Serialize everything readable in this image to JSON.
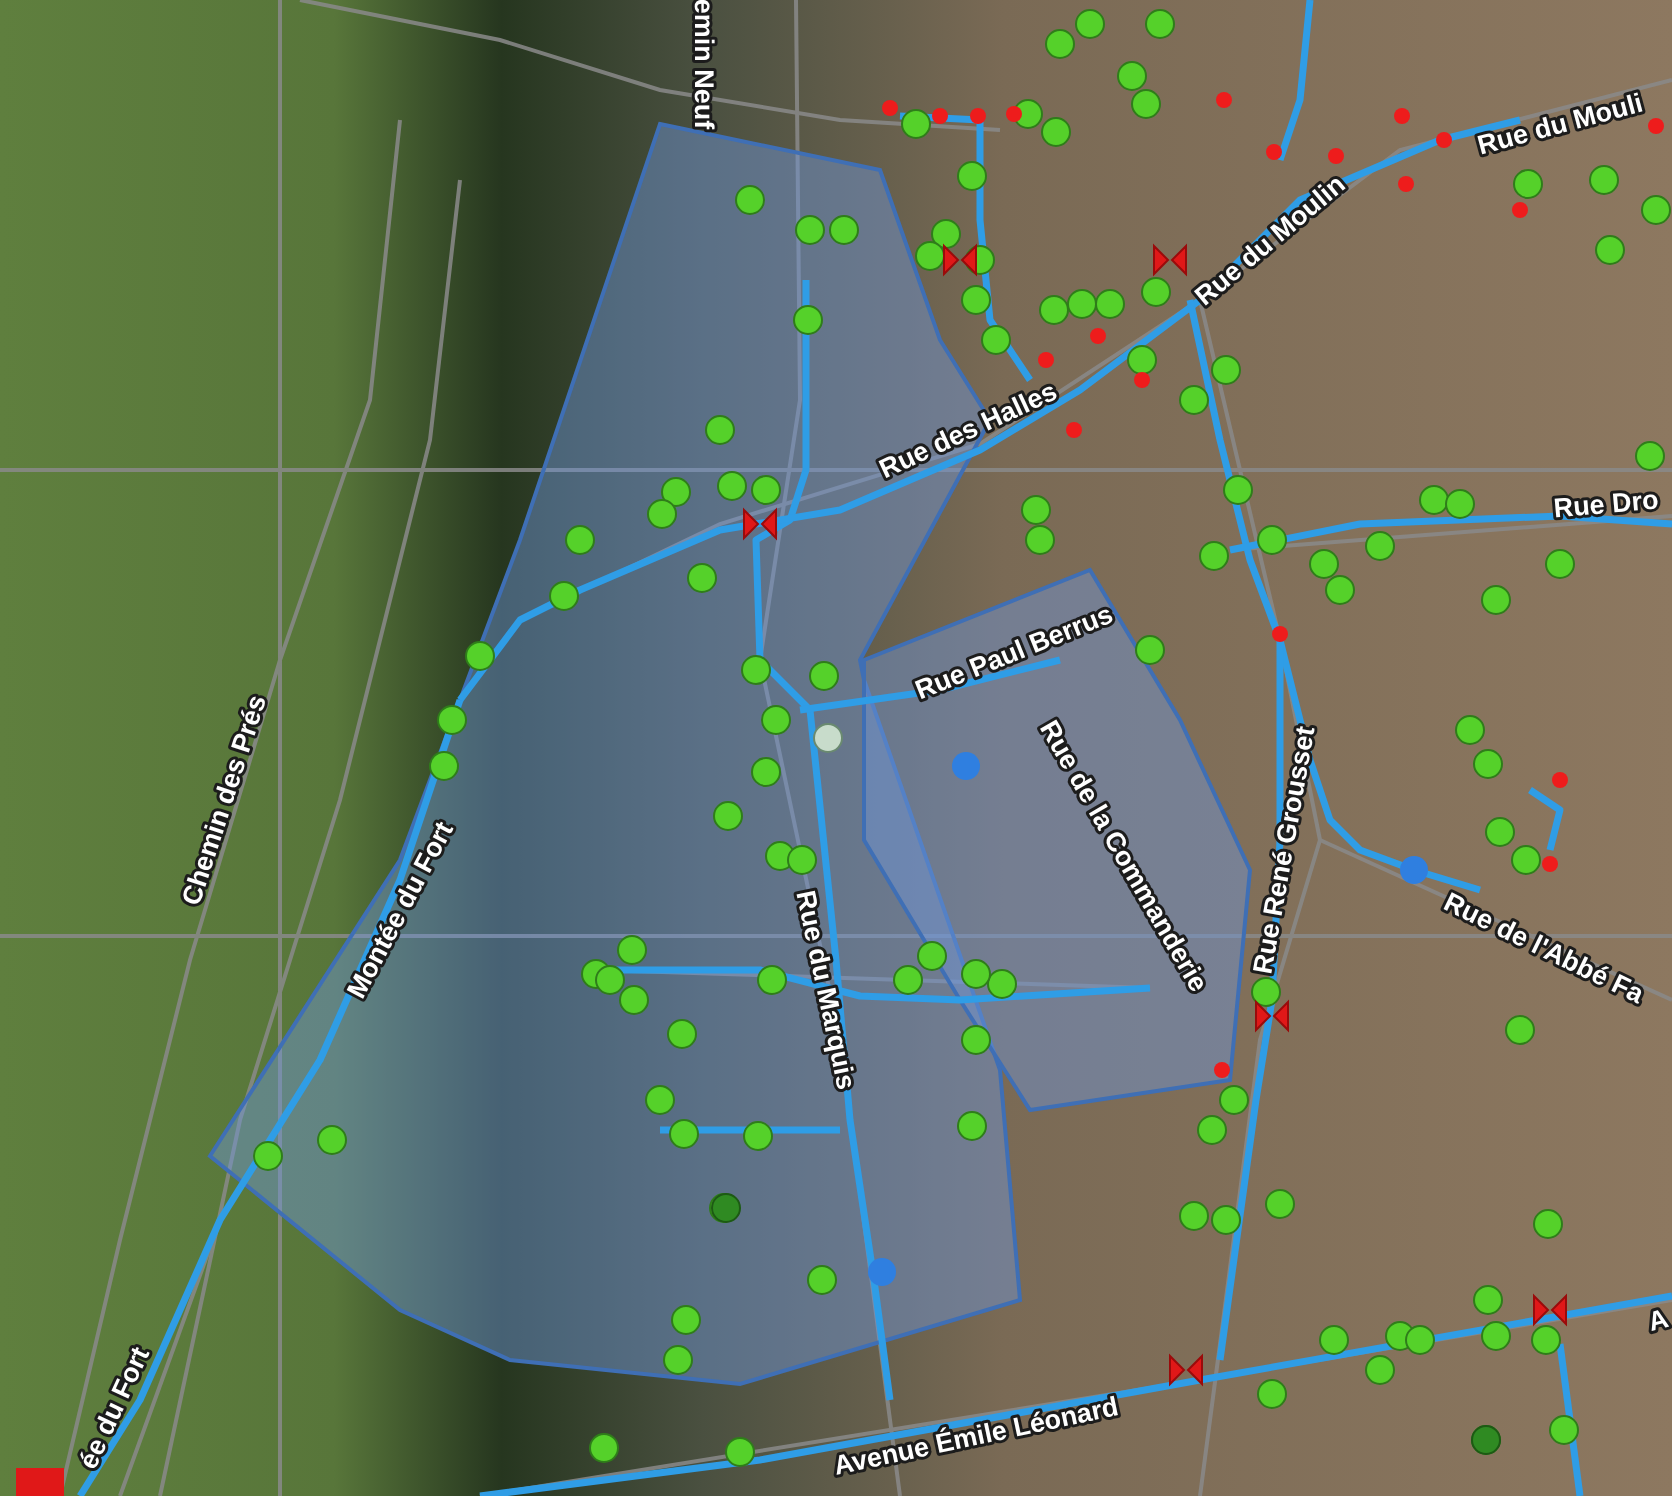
{
  "map": {
    "street_labels": [
      {
        "text": "emin Neuf"
      },
      {
        "text": "Rue du Moulin"
      },
      {
        "text": "Rue du Mouli"
      },
      {
        "text": "Rue des Halles"
      },
      {
        "text": "Rue Dro"
      },
      {
        "text": "Rue Paul Berrus"
      },
      {
        "text": "Rue de la Commanderie"
      },
      {
        "text": "Rue René Grousset"
      },
      {
        "text": "Rue de l'Abbé Fa"
      },
      {
        "text": "Chemin des Prés"
      },
      {
        "text": "Montée du Fort"
      },
      {
        "text": "Rue du Marquis"
      },
      {
        "text": "Avenue Émile Léonard"
      },
      {
        "text": "ée du Fort"
      },
      {
        "text": "A"
      }
    ]
  }
}
